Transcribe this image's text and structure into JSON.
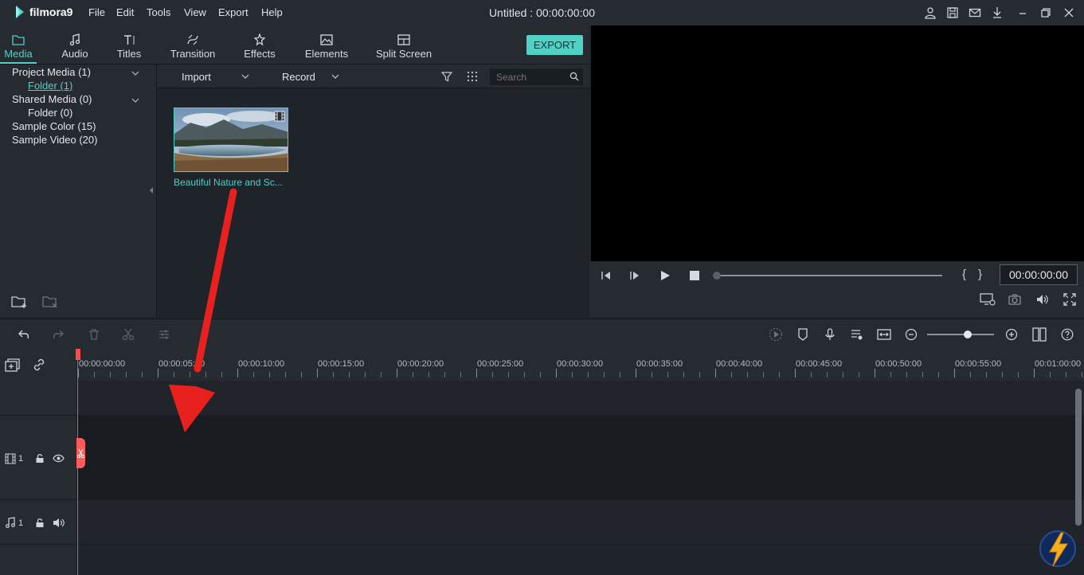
{
  "app": {
    "logo_text": "filmora9",
    "window_title": "Untitled : 00:00:00:00",
    "menu": [
      "File",
      "Edit",
      "Tools",
      "View",
      "Export",
      "Help"
    ]
  },
  "tabs": [
    {
      "label": "Media",
      "icon": "folder-icon",
      "active": true
    },
    {
      "label": "Audio",
      "icon": "music-note-icon",
      "active": false
    },
    {
      "label": "Titles",
      "icon": "text-icon",
      "active": false
    },
    {
      "label": "Transition",
      "icon": "transition-icon",
      "active": false
    },
    {
      "label": "Effects",
      "icon": "effects-icon",
      "active": false
    },
    {
      "label": "Elements",
      "icon": "image-icon",
      "active": false
    },
    {
      "label": "Split Screen",
      "icon": "split-screen-icon",
      "active": false
    }
  ],
  "export_label": "EXPORT",
  "sidebar": {
    "items": [
      {
        "label": "Project Media (1)",
        "expandable": true
      },
      {
        "label": "Folder (1)",
        "selected": true
      },
      {
        "label": "Shared Media (0)",
        "expandable": true
      },
      {
        "label": "Folder (0)"
      },
      {
        "label": "Sample Color (15)"
      },
      {
        "label": "Sample Video (20)"
      }
    ]
  },
  "media_toolbar": {
    "import_label": "Import",
    "record_label": "Record",
    "search_placeholder": "Search"
  },
  "media_items": [
    {
      "caption": "Beautiful Nature and Sc..."
    }
  ],
  "player": {
    "timecode": "00:00:00:00",
    "mark_in": "{",
    "mark_out": "}"
  },
  "timeline": {
    "ruler": [
      "00:00:00:00",
      "00:00:05:00",
      "00:00:10:00",
      "00:00:15:00",
      "00:00:20:00",
      "00:00:25:00",
      "00:00:30:00",
      "00:00:35:00",
      "00:00:40:00",
      "00:00:45:00",
      "00:00:50:00",
      "00:00:55:00",
      "00:01:00:00"
    ],
    "video_track_number": "1",
    "audio_track_number": "1"
  },
  "colors": {
    "accent": "#4fd1c5",
    "playhead": "#ff4d4d",
    "annotation_arrow": "#e8201e"
  }
}
